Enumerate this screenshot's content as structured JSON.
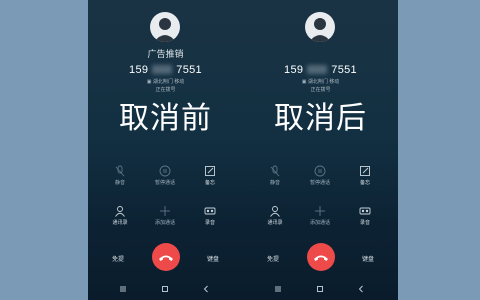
{
  "left_phone": {
    "caller_name": "广告推销",
    "number_prefix": "159",
    "number_suffix": "7551",
    "location": "▣ 湖北荆门 移动",
    "status": "正在拨号",
    "overlay_label": "取消前",
    "controls": {
      "mute": "静音",
      "hold": "暂停通话",
      "note": "备忘",
      "contacts": "通讯录",
      "add_call": "添加通话",
      "record": "录音",
      "speaker": "免提",
      "keypad": "键盘"
    }
  },
  "right_phone": {
    "caller_name": "",
    "number_prefix": "159",
    "number_suffix": "7551",
    "location": "▣ 湖北荆门 移动",
    "status": "正在拨号",
    "overlay_label": "取消后",
    "controls": {
      "mute": "静音",
      "hold": "暂停通话",
      "note": "备忘",
      "contacts": "通讯录",
      "add_call": "添加通话",
      "record": "录音",
      "speaker": "免提",
      "keypad": "键盘"
    }
  },
  "colors": {
    "page_background": "#7a9ab5",
    "screen_background": "#123042",
    "hangup_button": "#ee4a4a",
    "icon_color": "#c9d4dc"
  },
  "icons": [
    "avatar-icon",
    "mute-icon",
    "hold-icon",
    "note-icon",
    "contacts-icon",
    "add-call-icon",
    "record-icon",
    "hangup-icon",
    "menu-icon",
    "home-icon",
    "back-icon"
  ]
}
